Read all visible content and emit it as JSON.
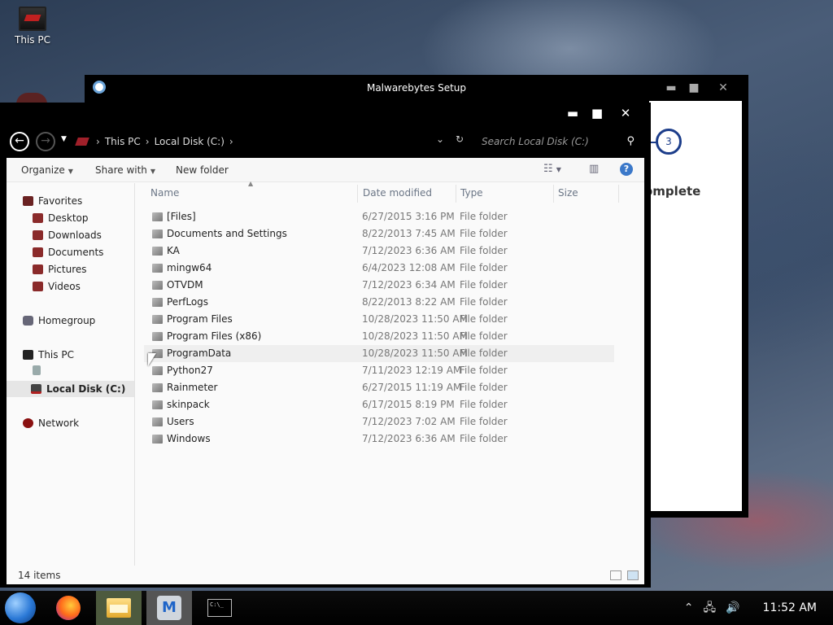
{
  "desktop": {
    "icons": [
      {
        "label": "This PC",
        "icon": "computer-icon"
      }
    ]
  },
  "malwarebytes": {
    "title": "Malwarebytes Setup",
    "step_number": "3",
    "step_label": "omplete",
    "controls": {
      "minimize": "▬",
      "maximize": "■",
      "close": "✕"
    }
  },
  "explorer": {
    "controls": {
      "minimize": "▬",
      "maximize": "■",
      "close": "✕"
    },
    "breadcrumb": [
      "This PC",
      "Local Disk (C:)"
    ],
    "search_placeholder": "Search Local Disk (C:)",
    "toolbar": {
      "organize": "Organize",
      "share_with": "Share with",
      "new_folder": "New folder"
    },
    "nav": {
      "favorites": "Favorites",
      "desktop": "Desktop",
      "downloads": "Downloads",
      "documents": "Documents",
      "pictures": "Pictures",
      "videos": "Videos",
      "homegroup": "Homegroup",
      "this_pc": "This PC",
      "local_disk": "Local Disk (C:)",
      "network": "Network"
    },
    "columns": {
      "name": "Name",
      "date": "Date modified",
      "type": "Type",
      "size": "Size"
    },
    "files": [
      {
        "name": "[Files]",
        "date": "6/27/2015 3:16 PM",
        "type": "File folder"
      },
      {
        "name": "Documents and Settings",
        "date": "8/22/2013 7:45 AM",
        "type": "File folder"
      },
      {
        "name": "KA",
        "date": "7/12/2023 6:36 AM",
        "type": "File folder"
      },
      {
        "name": "mingw64",
        "date": "6/4/2023 12:08 AM",
        "type": "File folder"
      },
      {
        "name": "OTVDM",
        "date": "7/12/2023 6:34 AM",
        "type": "File folder"
      },
      {
        "name": "PerfLogs",
        "date": "8/22/2013 8:22 AM",
        "type": "File folder"
      },
      {
        "name": "Program Files",
        "date": "10/28/2023 11:50 AM",
        "type": "File folder"
      },
      {
        "name": "Program Files (x86)",
        "date": "10/28/2023 11:50 AM",
        "type": "File folder"
      },
      {
        "name": "ProgramData",
        "date": "10/28/2023 11:50 AM",
        "type": "File folder"
      },
      {
        "name": "Python27",
        "date": "7/11/2023 12:19 AM",
        "type": "File folder"
      },
      {
        "name": "Rainmeter",
        "date": "6/27/2015 11:19 AM",
        "type": "File folder"
      },
      {
        "name": "skinpack",
        "date": "6/17/2015 8:19 PM",
        "type": "File folder"
      },
      {
        "name": "Users",
        "date": "7/12/2023 7:02 AM",
        "type": "File folder"
      },
      {
        "name": "Windows",
        "date": "7/12/2023 6:36 AM",
        "type": "File folder"
      }
    ],
    "status": "14 items"
  },
  "taskbar": {
    "clock": "11:52 AM",
    "cmd_text": "C:\\_"
  }
}
